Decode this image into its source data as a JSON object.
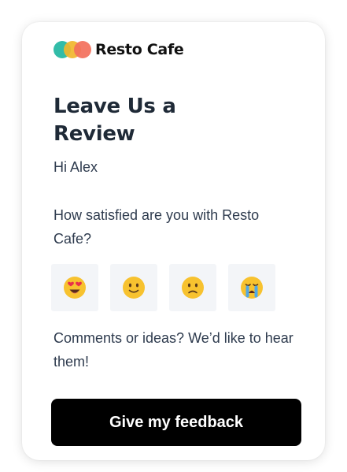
{
  "brand": {
    "name": "Resto Cafe",
    "logo_colors": [
      "#27b8a3",
      "#f1b62c",
      "#f3705c"
    ]
  },
  "title": "Leave Us a Review",
  "greeting": "Hi Alex",
  "question": "How satisfied are you with Resto Cafe?",
  "ratings": [
    {
      "name": "heart-eyes-emoji-icon"
    },
    {
      "name": "slightly-smiling-emoji-icon"
    },
    {
      "name": "slightly-frowning-emoji-icon"
    },
    {
      "name": "crying-emoji-icon"
    }
  ],
  "comments_prompt": "Comments or ideas? We’d like to hear them!",
  "cta_label": "Give my feedback",
  "colors": {
    "button_bg": "#000000",
    "button_text": "#ffffff",
    "rating_tile_bg": "#f3f5f8",
    "emoji_face": "#f7c22f",
    "text": "#1f2a37"
  }
}
